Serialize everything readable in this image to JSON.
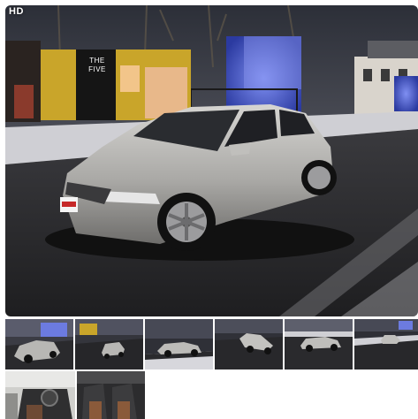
{
  "main_photo": {
    "badge": "HD",
    "sign_text": [
      "THE",
      "FIVE"
    ],
    "sign_subtext": "",
    "plate_text": "",
    "colors": {
      "sky": "#3a3d46",
      "ground": "#2b2b2e",
      "car_body": "#b9b8b6",
      "shop_yellow": "#c9a52a",
      "blue_light": "#4f63d6"
    }
  },
  "thumbnails": [
    {
      "scene": "car-side-left-lights"
    },
    {
      "scene": "car-front-street"
    },
    {
      "scene": "car-side-snow"
    },
    {
      "scene": "car-rear-angle"
    },
    {
      "scene": "car-side-parking"
    },
    {
      "scene": "car-far-night"
    },
    {
      "scene": "interior-front"
    },
    {
      "scene": "interior-seats"
    }
  ]
}
